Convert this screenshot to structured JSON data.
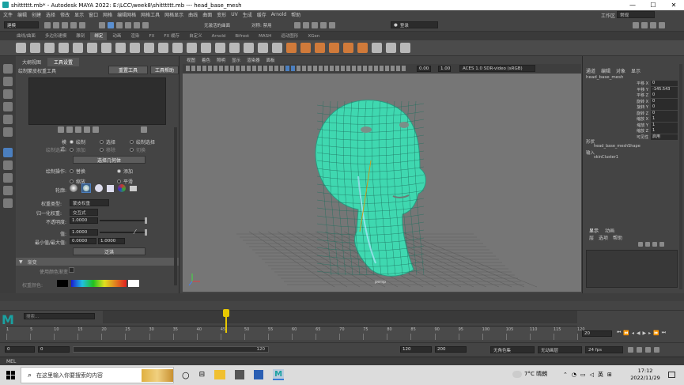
{
  "window": {
    "title": "shitttttt.mb* - Autodesk MAYA 2022: E:\\LCC\\week8\\shitttttt.mb   ---   head_base_mesh",
    "min": "—",
    "max": "☐",
    "close": "✕"
  },
  "menubar": {
    "items": [
      "文件",
      "编辑",
      "创建",
      "选择",
      "修改",
      "显示",
      "窗口",
      "网格",
      "编辑网格",
      "网格工具",
      "网格显示",
      "曲线",
      "曲面",
      "变形",
      "UV",
      "生成",
      "缓存",
      "Arnold",
      "帮助"
    ],
    "workspace_label": "工作区",
    "workspace_value": "常规"
  },
  "status": {
    "mode": "建模",
    "no_live": "无激活的曲面",
    "symmetry": "对称: 禁用",
    "login": "登录"
  },
  "shelf_tabs": [
    "曲线/曲面",
    "多边形建模",
    "雕刻",
    "绑定",
    "动画",
    "渲染",
    "FX",
    "FX 缓存",
    "自定义",
    "Arnold",
    "Bifrost",
    "MASH",
    "运动图形",
    "XGen"
  ],
  "shelf_active": "绑定",
  "tool_panel": {
    "tabs": [
      "大纲视图",
      "工具设置"
    ],
    "tool_name": "绘制蒙皮权重工具",
    "reset_button": "重置工具",
    "help_button": "工具帮助",
    "mode_label": "模式:",
    "mode_options": [
      "绘制",
      "选择",
      "绘制选择"
    ],
    "paint_select_label": "绘制选择:",
    "paint_select_options": [
      "添加",
      "移除",
      "切换"
    ],
    "select_geo_button": "选择几何体",
    "paint_op_label": "绘制操作:",
    "paint_ops": [
      "替换",
      "添加",
      "缩放",
      "平滑"
    ],
    "profile_label": "轮廓:",
    "weight_type_label": "权重类型:",
    "weight_type_value": "蒙皮权重",
    "normalize_label": "归一化权重:",
    "normalize_value": "交互式",
    "opacity_label": "不透明度:",
    "opacity_value": "1.0000",
    "value_label": "值:",
    "value_value": "1.0000",
    "minmax_label": "最小值/最大值:",
    "min_value": "0.0000",
    "max_value": "1.0000",
    "flood_button": "泛洪",
    "gradient_section": "渐变",
    "use_color_ramp": "使用颜色渐变",
    "weight_color_label": "权重颜色:"
  },
  "viewport": {
    "menu": [
      "视图",
      "着色",
      "照明",
      "显示",
      "渲染器",
      "面板"
    ],
    "readout_a": "0.00",
    "readout_b": "1.00",
    "color_space": "ACES 1.0 SDR-video (sRGB)",
    "camera_label": "persp"
  },
  "channel_box": {
    "tabs": [
      "通道",
      "编辑",
      "对象",
      "显示"
    ],
    "object_name": "head_base_mesh",
    "attrs": [
      {
        "label": "平移 X",
        "value": "0"
      },
      {
        "label": "平移 Y",
        "value": "-145.543"
      },
      {
        "label": "平移 Z",
        "value": "0"
      },
      {
        "label": "旋转 X",
        "value": "0"
      },
      {
        "label": "旋转 Y",
        "value": "0"
      },
      {
        "label": "旋转 Z",
        "value": "0"
      },
      {
        "label": "缩放 X",
        "value": "1"
      },
      {
        "label": "缩放 Y",
        "value": "1"
      },
      {
        "label": "缩放 Z",
        "value": "1"
      },
      {
        "label": "可见性",
        "value": "启用"
      }
    ],
    "shapes_header": "形状",
    "shape_name": "head_base_meshShape",
    "inputs_header": "输入",
    "input_name": "skinCluster1",
    "layer_tabs": [
      "显示",
      "动画"
    ],
    "layer_menu": [
      "层",
      "选项",
      "帮助"
    ]
  },
  "timeline": {
    "ticks": [
      "1",
      "5",
      "10",
      "15",
      "20",
      "25",
      "30",
      "35",
      "40",
      "45",
      "50",
      "55",
      "60",
      "65",
      "70",
      "75",
      "80",
      "85",
      "90",
      "95",
      "100",
      "105",
      "110",
      "115",
      "120"
    ],
    "current_frame": "20",
    "current_frame_field": "20",
    "start": "0",
    "range_start": "0",
    "range_end": "120",
    "end": "120",
    "anim_end": "200",
    "char_set": "无角色集",
    "anim_layer": "无动画层",
    "fps": "24 fps",
    "search_placeholder": "搜索..."
  },
  "mel": {
    "label": "MEL"
  },
  "taskbar": {
    "search_placeholder": "在这里输入你要搜索的内容",
    "weather": "7°C 晴朗",
    "ime": "英",
    "time": "17:12",
    "date": "2022/11/29"
  },
  "colors": {
    "mesh": "#3fd8b0",
    "viewport_bg": "#767676",
    "accent_blue": "#4b7fbf",
    "current_frame": "#e8c800"
  }
}
